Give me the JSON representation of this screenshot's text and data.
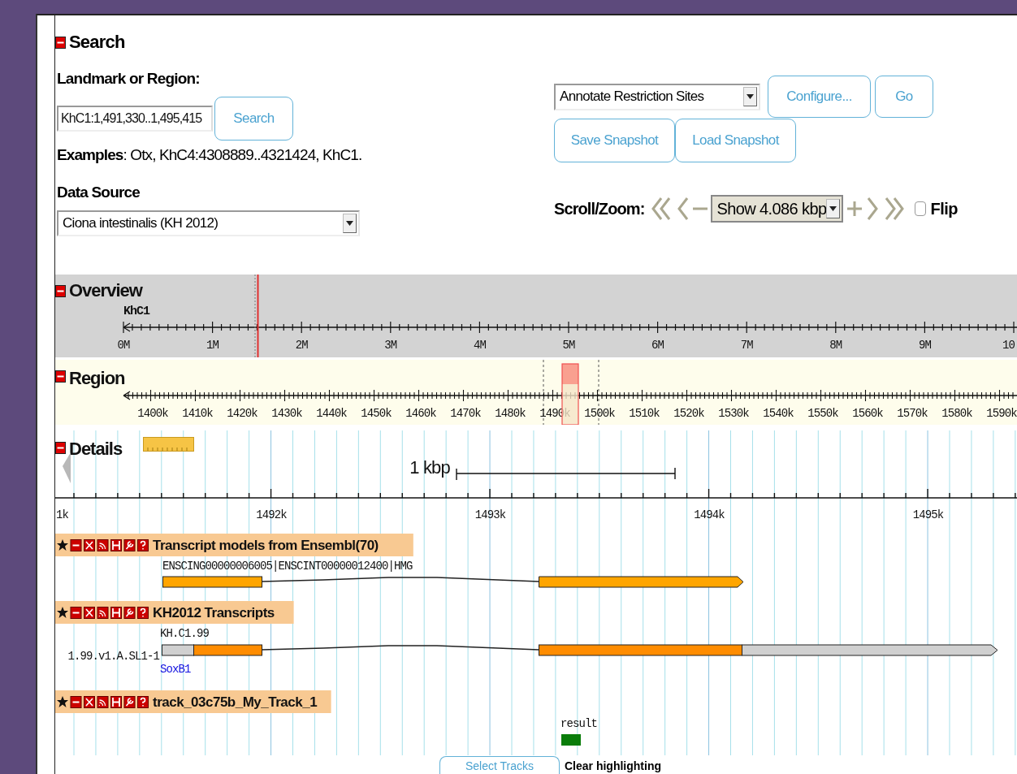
{
  "search": {
    "title": "Search",
    "expanded": true,
    "landmark_label": "Landmark or Region:",
    "landmark_value": "KhC1:1,491,330..1,495,415",
    "search_button": "Search",
    "examples": "**Examples**: Otx, KhC4:4308889..4321424, KhC1.",
    "data_source_label": "Data Source",
    "data_source_value": "Ciona intestinalis (KH 2012)"
  },
  "plugin": {
    "value": "Annotate Restriction Sites",
    "configure_button": "Configure...",
    "go_button": "Go"
  },
  "snapshot_buttons": [
    "Save Snapshot",
    "Load Snapshot"
  ],
  "scroll_zoom": {
    "label": "Scroll/Zoom:",
    "zoom_value": "Show 4.086 kbp",
    "flip": {
      "label": "Flip",
      "checked": false
    }
  },
  "overview": {
    "title": "Overview",
    "expanded": true,
    "chromosome": "KhC1",
    "ticks": [
      "0M",
      "1M",
      "2M",
      "3M",
      "4M",
      "5M",
      "6M",
      "7M",
      "8M",
      "9M",
      "10"
    ]
  },
  "region": {
    "title": "Region",
    "expanded": true,
    "ticks": [
      "1400k",
      "1410k",
      "1420k",
      "1430k",
      "1440k",
      "1450k",
      "1460k",
      "1470k",
      "1480k",
      "1490k",
      "1500k",
      "1510k",
      "1520k",
      "1530k",
      "1540k",
      "1550k",
      "1560k",
      "1570k",
      "1580k",
      "1590k"
    ]
  },
  "details": {
    "title": "Details",
    "expanded": true,
    "scale": "1 kbp",
    "ticks": [
      "1k",
      "1492k",
      "1493k",
      "1494k",
      "1495k"
    ],
    "tracks": [
      {
        "title": "Transcript models from Ensembl(70)",
        "kind": "coding",
        "feature_label": "ENSCING00000006005|ENSCINT00000012400|HMG"
      },
      {
        "title": "KH2012 Transcripts",
        "kind": "utr",
        "feature_label": "KH.C1.99",
        "side_label": "1.99.v1.A.SL1-1",
        "link": "SoxB1"
      },
      {
        "title": "track_03c75b_My_Track_1",
        "kind": "hit",
        "feature_label": "result"
      }
    ]
  },
  "bottom": {
    "select_button": "Select Tracks",
    "clear_link": "Clear highlighting"
  }
}
